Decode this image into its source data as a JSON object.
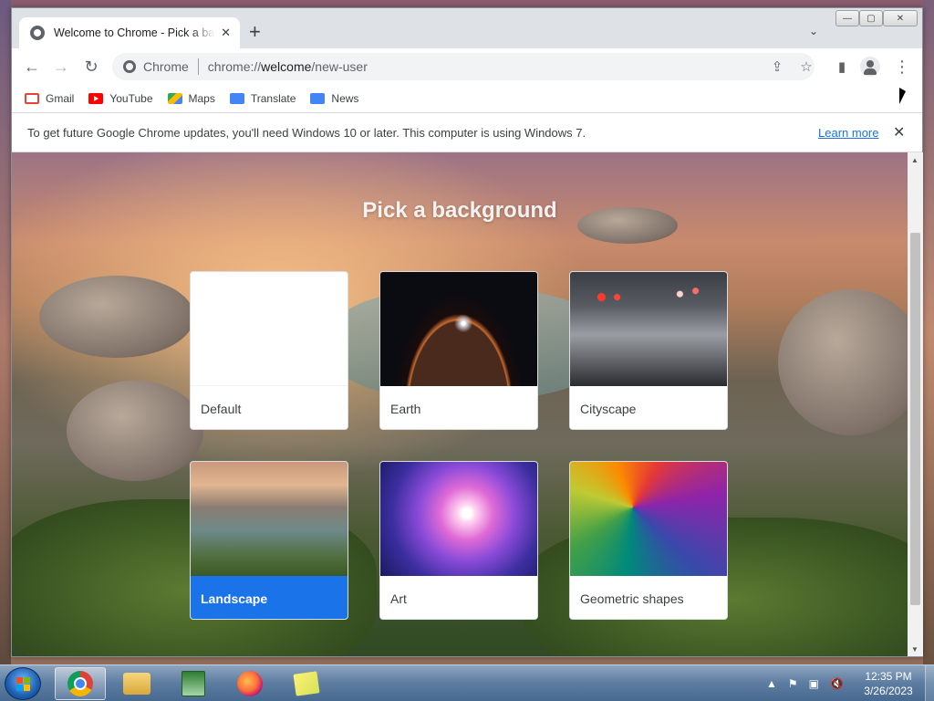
{
  "browser": {
    "tab": {
      "title": "Welcome to Chrome - Pick a background",
      "close": "✕"
    },
    "new_tab": "+",
    "tab_search": "⌄",
    "window_controls": {
      "minimize": "—",
      "maximize": "▢",
      "close": "✕"
    },
    "nav": {
      "back": "←",
      "forward": "→",
      "reload": "↻"
    },
    "omnibox": {
      "chip": "Chrome",
      "url_scheme": "chrome://",
      "url_host": "welcome",
      "url_path": "/new-user"
    },
    "toolbar_icons": {
      "share": "⇪",
      "bookmark": "☆",
      "side_panel": "▮",
      "menu": "⋮"
    },
    "bookmarks": [
      {
        "label": "Gmail",
        "icon": "gmail-icon"
      },
      {
        "label": "YouTube",
        "icon": "youtube-icon"
      },
      {
        "label": "Maps",
        "icon": "maps-icon"
      },
      {
        "label": "Translate",
        "icon": "translate-icon"
      },
      {
        "label": "News",
        "icon": "news-icon"
      }
    ],
    "infobar": {
      "message": "To get future Google Chrome updates, you'll need Windows 10 or later. This computer is using Windows 7.",
      "link": "Learn more",
      "close": "✕"
    }
  },
  "page": {
    "heading": "Pick a background",
    "backgrounds": [
      {
        "label": "Default",
        "selected": false
      },
      {
        "label": "Earth",
        "selected": false
      },
      {
        "label": "Cityscape",
        "selected": false
      },
      {
        "label": "Landscape",
        "selected": true
      },
      {
        "label": "Art",
        "selected": false
      },
      {
        "label": "Geometric shapes",
        "selected": false
      }
    ],
    "scroll": {
      "up": "▲",
      "down": "▼"
    }
  },
  "taskbar": {
    "clock": {
      "time": "12:35 PM",
      "date": "3/26/2023"
    },
    "tray": {
      "arrow": "▲"
    },
    "apps": [
      "chrome-icon",
      "file-explorer-icon",
      "task-monitor-icon",
      "firefox-icon",
      "sticky-notes-icon"
    ]
  },
  "colors": {
    "accent": "#1a73e8",
    "tab_strip": "#dee1e6"
  }
}
